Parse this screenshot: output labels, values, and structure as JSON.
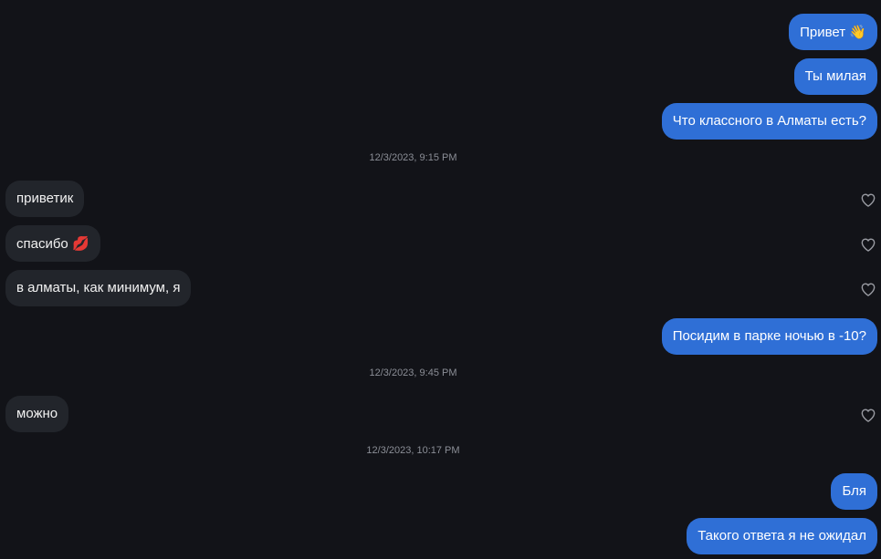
{
  "messages": [
    {
      "side": "out",
      "text": "Привет",
      "emoji": "👋"
    },
    {
      "side": "out",
      "text": "Ты милая",
      "emoji": ""
    },
    {
      "side": "out",
      "text": "Что классного в Алматы есть?",
      "emoji": ""
    },
    {
      "side": "stamp",
      "text": "12/3/2023, 9:15 PM"
    },
    {
      "side": "in",
      "text": "приветик",
      "emoji": ""
    },
    {
      "side": "in",
      "text": "спасибо",
      "emoji": "💋"
    },
    {
      "side": "in",
      "text": "в алматы, как минимум, я",
      "emoji": ""
    },
    {
      "side": "out",
      "text": "Посидим в парке ночью в -10?",
      "emoji": ""
    },
    {
      "side": "stamp",
      "text": "12/3/2023, 9:45 PM"
    },
    {
      "side": "in",
      "text": "можно",
      "emoji": ""
    },
    {
      "side": "stamp",
      "text": "12/3/2023, 10:17 PM"
    },
    {
      "side": "out",
      "text": "Бля",
      "emoji": ""
    },
    {
      "side": "out",
      "text": "Такого ответа я не ожидал",
      "emoji": ""
    }
  ],
  "icons": {
    "like": "heart-outline-icon"
  },
  "colors": {
    "background": "#121318",
    "outgoing_bubble": "#2f6fd6",
    "incoming_bubble": "#22252b",
    "timestamp": "#8b8e96",
    "heart": "#9a9ca3"
  }
}
